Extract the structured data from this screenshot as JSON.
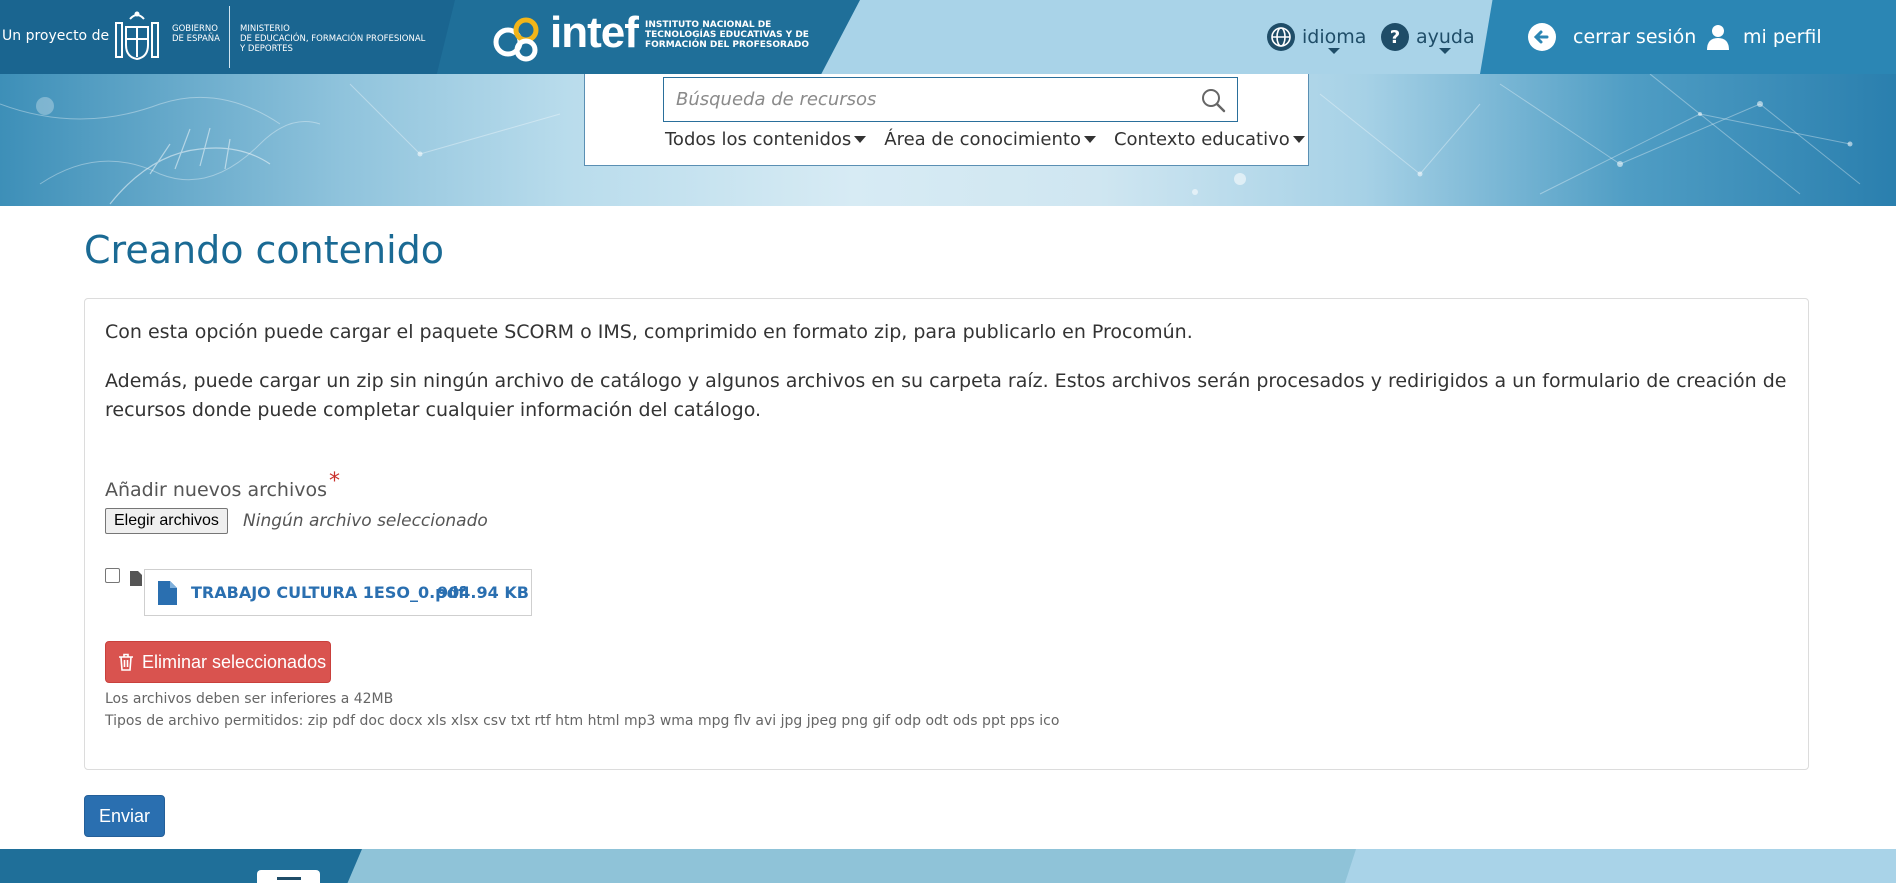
{
  "header": {
    "project_label": "Un proyecto de",
    "gobierno": [
      "GOBIERNO",
      "DE ESPAÑA"
    ],
    "ministerio": [
      "MINISTERIO",
      "DE EDUCACIÓN, FORMACIÓN PROFESIONAL",
      "Y DEPORTES"
    ],
    "intef_word": "intef",
    "intef_subtitle": [
      "INSTITUTO NACIONAL DE",
      "TECNOLOGÍAS EDUCATIVAS Y DE",
      "FORMACIÓN DEL PROFESORADO"
    ],
    "language_label": "idioma",
    "help_label": "ayuda",
    "logout_label": "cerrar sesión",
    "profile_label": "mi perfil"
  },
  "search": {
    "placeholder": "Búsqueda de recursos",
    "filters": [
      "Todos los contenidos",
      "Área de conocimiento",
      "Contexto educativo"
    ]
  },
  "main": {
    "title": "Creando contenido",
    "intro_1": "Con esta opción puede cargar el paquete SCORM o IMS, comprimido en formato zip, para publicarlo en Procomún.",
    "intro_2": "Además, puede cargar un zip sin ningún archivo de catálogo y algunos archivos en su carpeta raíz. Estos archivos serán procesados y redirigidos a un formulario de creación de recursos donde puede completar cualquier información del catálogo.",
    "add_files_label": "Añadir nuevos archivos",
    "required_mark": "*",
    "choose_button": "Elegir archivos",
    "no_file_text": "Ningún archivo seleccionado",
    "file": {
      "name": "TRABAJO CULTURA 1ESO_0.pdf",
      "size": "904.94 KB"
    },
    "delete_button": "Eliminar seleccionados",
    "size_hint": "Los archivos deben ser inferiores a 42MB",
    "types_hint": "Tipos de archivo permitidos: zip pdf doc docx xls xlsx csv txt rtf htm html mp3 wma mpg flv avi jpg jpeg png gif odp odt ods ppt pps ico",
    "submit_button": "Enviar"
  },
  "colors": {
    "primary": "#1a6a94",
    "link": "#2a6fb0",
    "danger": "#d9534f",
    "accent_yellow": "#f2b519"
  }
}
